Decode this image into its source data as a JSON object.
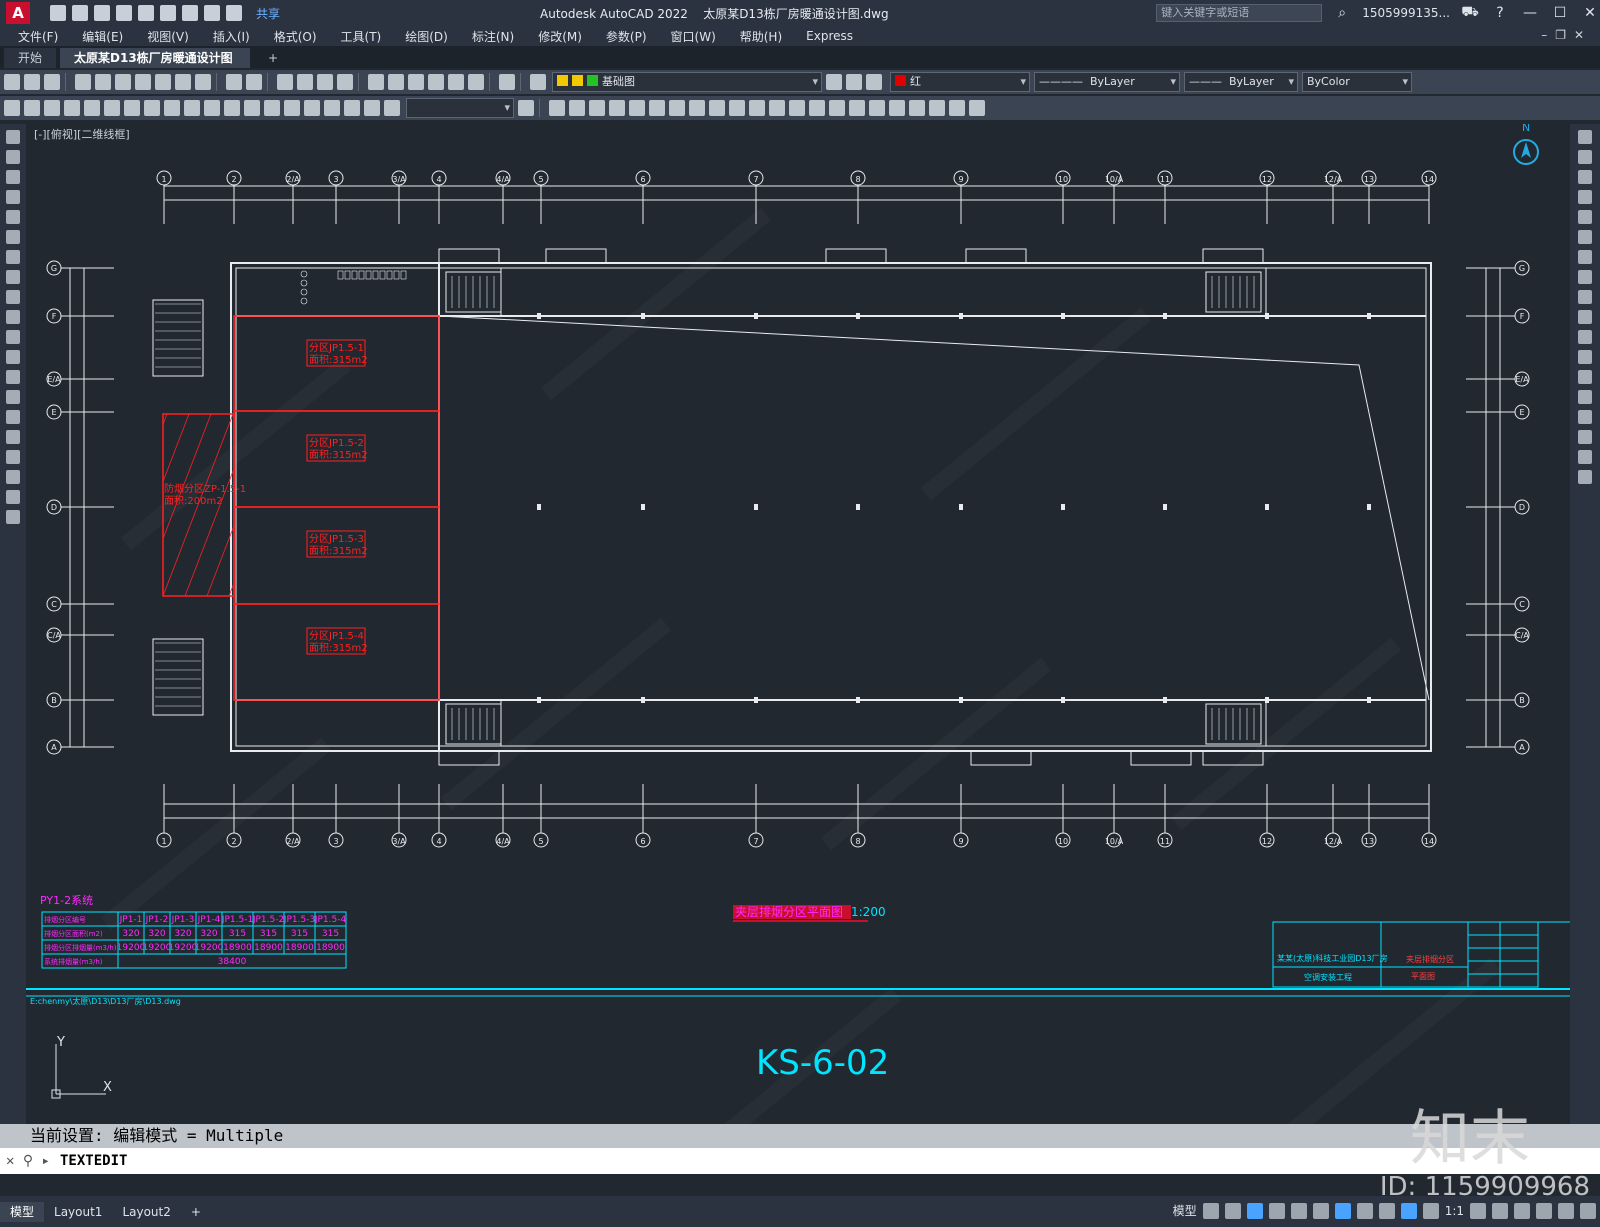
{
  "title_bar": {
    "app_title": "Autodesk AutoCAD 2022",
    "file_name": "太原某D13栋厂房暖通设计图.dwg",
    "share_label": "共享",
    "search_placeholder": "键入关键字或短语",
    "user": "1505999135..."
  },
  "menu": [
    "文件(F)",
    "编辑(E)",
    "视图(V)",
    "插入(I)",
    "格式(O)",
    "工具(T)",
    "绘图(D)",
    "标注(N)",
    "修改(M)",
    "参数(P)",
    "窗口(W)",
    "帮助(H)",
    "Express"
  ],
  "tabs": [
    {
      "label": "开始",
      "active": false
    },
    {
      "label": "太原某D13栋厂房暖通设计图*",
      "active": true
    }
  ],
  "toolbar": {
    "layer": "基础图",
    "color": "红",
    "color_hex": "#e00000",
    "linetype": "ByLayer",
    "lineweight": "ByLayer",
    "plotstyle": "ByColor"
  },
  "viewport": {
    "label": "[-][俯视][二维线框]",
    "compass_north": "N"
  },
  "drawing": {
    "grid_numbers_top": [
      "1",
      "2",
      "2/A",
      "3",
      "3/A",
      "4",
      "4/A",
      "5",
      "6",
      "7",
      "8",
      "9",
      "10",
      "10/A",
      "11",
      "12",
      "12/A",
      "13",
      "14"
    ],
    "grid_letters": [
      "G",
      "F",
      "E/A",
      "E",
      "D",
      "C",
      "C/A",
      "B",
      "A"
    ],
    "rooms": [
      {
        "code": "分区JP1.5-1",
        "area": "面积:315m2"
      },
      {
        "code": "分区JP1.5-2",
        "area": "面积:315m2"
      },
      {
        "code": "分区JP1.5-3",
        "area": "面积:315m2"
      },
      {
        "code": "分区JP1.5-4",
        "area": "面积:315m2"
      }
    ],
    "hatch_zone": {
      "code": "防烟分区ZP-1.5-1",
      "area": "面积:200m2"
    },
    "plan_title": "夹层排烟分区平面图",
    "plan_scale": "1:200",
    "file_path": "E:chenmy\\太原\\D13\\D13厂房\\D13.dwg",
    "sheet_no": "KS-6-02",
    "title_block": {
      "project": "某某(太原)科技工业园D13厂房",
      "subproject": "空调安装工程",
      "drawing_name": "夹层排烟分区",
      "drawing_sub": "平面图"
    },
    "ucs_x": "X",
    "ucs_y": "Y"
  },
  "py_table": {
    "title": "PY1-2系统",
    "headers": [
      "排烟分区编号",
      "JP1-1",
      "JP1-2",
      "JP1-3",
      "JP1-4",
      "JP1.5-1",
      "JP1.5-2",
      "JP1.5-3",
      "JP1.5-4"
    ],
    "row_area_label": "排烟分区面积(m2)",
    "row_area": [
      "320",
      "320",
      "320",
      "320",
      "315",
      "315",
      "315",
      "315"
    ],
    "row_flow_label": "排烟分区排烟量(m3/h)",
    "row_flow": [
      "19200",
      "19200",
      "19200",
      "19200",
      "18900",
      "18900",
      "18900",
      "18900"
    ],
    "row_total_label": "系统排烟量(m3/h)",
    "row_total": "38400"
  },
  "command": {
    "history": "当前设置: 编辑模式 = Multiple",
    "current": "TEXTEDIT"
  },
  "status": {
    "model_label": "模型",
    "layout_tabs": [
      "模型",
      "Layout1",
      "Layout2"
    ],
    "scale": "1:1"
  },
  "watermark": {
    "brand": "知末",
    "id": "ID: 1159909968"
  }
}
